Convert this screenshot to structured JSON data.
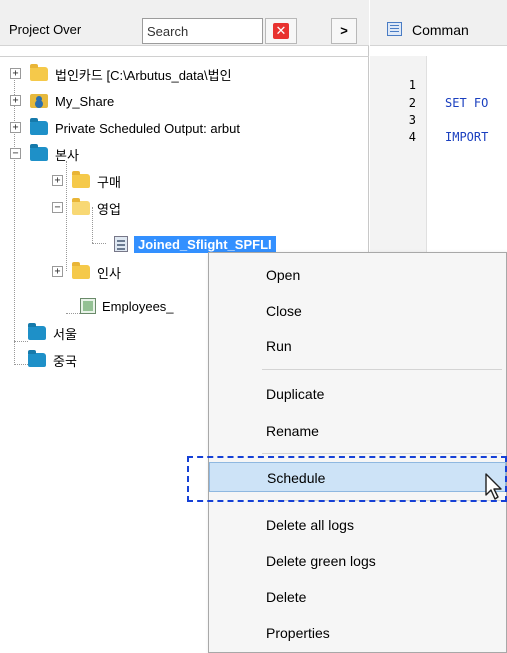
{
  "left_pane": {
    "title": "Project Over",
    "search_placeholder": "Search",
    "expand_label": ">"
  },
  "tree": {
    "items": [
      {
        "label": "법인카드 [C:\\Arbutus_data\\법인"
      },
      {
        "label": "My_Share"
      },
      {
        "label": "Private Scheduled Output:  arbut"
      },
      {
        "label": "본사"
      },
      {
        "label": "구매"
      },
      {
        "label": "영업"
      },
      {
        "label": "Joined_Sflight_SPFLI"
      },
      {
        "label": "인사"
      },
      {
        "label": "Employees_"
      },
      {
        "label": "서울"
      },
      {
        "label": "중국"
      }
    ]
  },
  "editor": {
    "tab_label": "Comman",
    "line_numbers": [
      "1",
      "2",
      "3",
      "4"
    ],
    "code_lines": [
      "",
      "SET FO",
      "",
      "IMPORT"
    ]
  },
  "context_menu": {
    "items": [
      "Open",
      "Close",
      "Run",
      "Duplicate",
      "Rename",
      "Schedule",
      "Delete all logs",
      "Delete green logs",
      "Delete",
      "Properties"
    ]
  },
  "colors": {
    "selection": "#3390ff",
    "menu_highlight": "#cde3f7",
    "annotation_border": "#1540d6",
    "code_text": "#1a3fbf"
  }
}
